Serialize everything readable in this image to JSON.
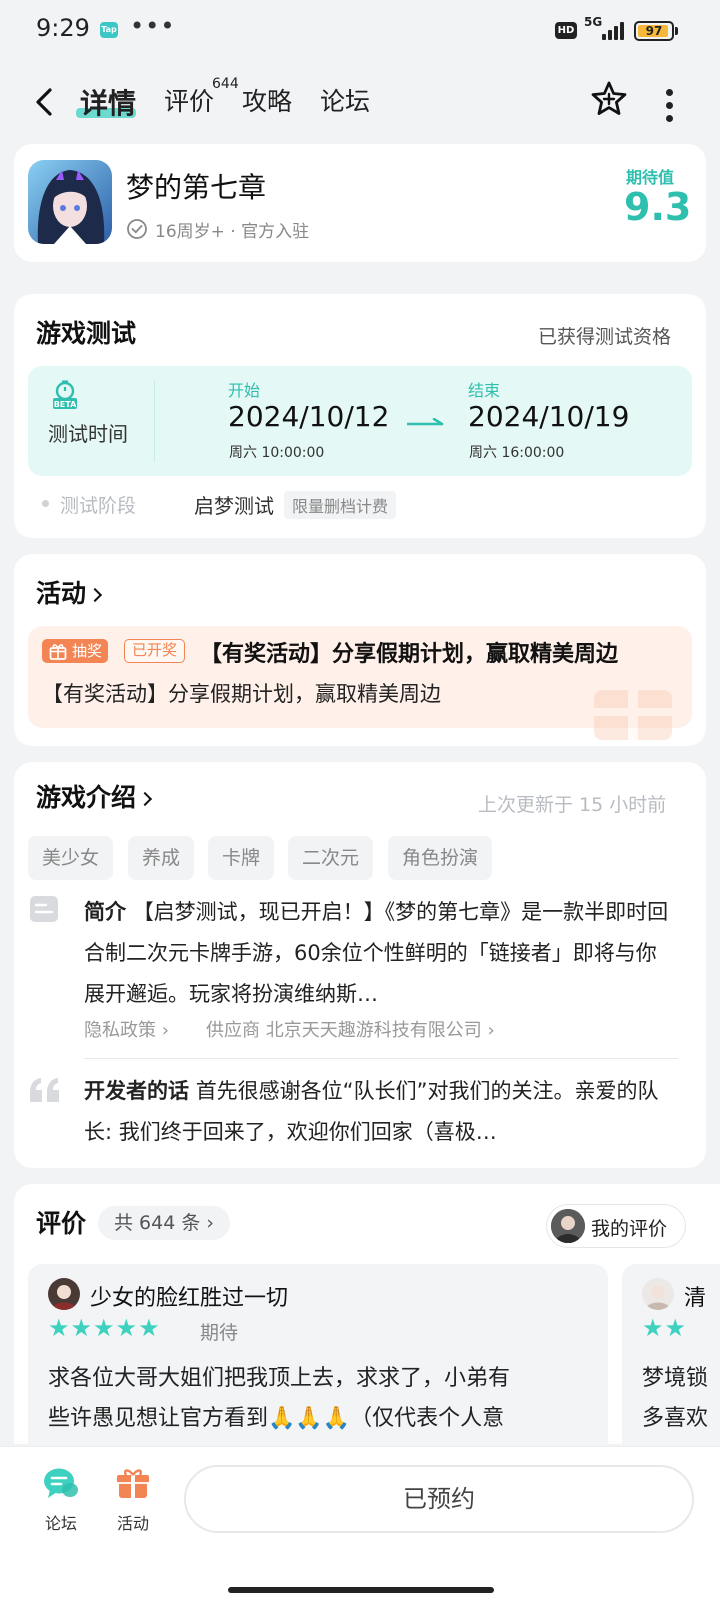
{
  "status_bar": {
    "time": "9:29",
    "tap_label": "Tap",
    "dots": "•••",
    "hd": "HD",
    "network": "5G",
    "battery": "97"
  },
  "header": {
    "tabs": [
      {
        "label": "详情"
      },
      {
        "label": "评价"
      },
      {
        "label": "攻略"
      },
      {
        "label": "论坛"
      }
    ],
    "review_badge": "644",
    "accent": "#3fd1c0"
  },
  "game": {
    "title": "梦的第七章",
    "meta": "16周岁+ · 官方入驻",
    "expect_label": "期待值",
    "expect_value": "9.3"
  },
  "test": {
    "section_title": "游戏测试",
    "status": "已获得测试资格",
    "beta_label": "BETA",
    "time_label": "测试时间",
    "start_label": "开始",
    "start_date": "2024/10/12",
    "start_sub": "周六  10:00:00",
    "end_label": "结束",
    "end_date": "2024/10/19",
    "end_sub": "周六  16:00:00",
    "stage_label": "测试阶段",
    "stage_value": "启梦测试",
    "stage_tag": "限量删档计费"
  },
  "activity": {
    "section_title": "活动",
    "lottery_tag": "抽奖",
    "open_tag": "已开奖",
    "title": "【有奖活动】分享假期计划，赢取精美周边",
    "desc": "【有奖活动】分享假期计划，赢取精美周边"
  },
  "intro": {
    "section_title": "游戏介绍",
    "updated": "上次更新于 15 小时前",
    "tags": [
      "美少女",
      "养成",
      "卡牌",
      "二次元",
      "角色扮演"
    ],
    "intro_label": "简介",
    "intro_body": "【启梦测试，现已开启！】《梦的第七章》是一款半即时回合制二次元卡牌手游，60余位个性鲜明的「链接者」即将与你展开邂逅。玩家将扮演维纳斯…",
    "privacy_link": "隐私政策",
    "supplier_label": "供应商",
    "supplier_name": "北京天天趣游科技有限公司",
    "dev_label": "开发者的话",
    "dev_body": "首先很感谢各位“队长们”对我们的关注。亲爱的队长: 我们终于回来了，欢迎你们回家（喜极…"
  },
  "reviews": {
    "section_title": "评价",
    "count": "共 644 条",
    "my_review": "我的评价",
    "items": [
      {
        "user": "少女的脸红胜过一切",
        "stars": "★★★★★",
        "status": "期待",
        "text_1": "求各位大哥大姐们把我顶上去，求求了，小弟有",
        "text_2": "些许愚见想让官方看到🙏🙏🙏（仅代表个人意"
      },
      {
        "user": "清",
        "stars": "★★",
        "status": "",
        "text_1": "梦境锁",
        "text_2": "多喜欢"
      }
    ]
  },
  "bottom_bar": {
    "forum_label": "论坛",
    "activity_label": "活动",
    "reserve_label": "已预约"
  }
}
